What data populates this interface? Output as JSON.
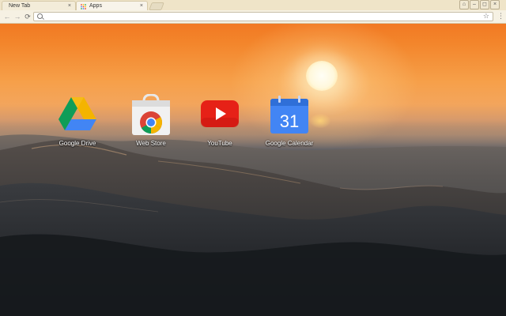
{
  "browser": {
    "tabs": [
      {
        "label": "New Tab",
        "close": "×"
      },
      {
        "label": "Apps",
        "close": "×"
      }
    ],
    "address": {
      "value": "",
      "placeholder": ""
    },
    "nav": {
      "back": "←",
      "forward": "→",
      "reload": "⟳"
    },
    "menu": "⋮",
    "star": "☆"
  },
  "apps": [
    {
      "label": "Google Drive",
      "icon": "google-drive-icon"
    },
    {
      "label": "Web Store",
      "icon": "chrome-web-store-icon"
    },
    {
      "label": "YouTube",
      "icon": "youtube-icon"
    },
    {
      "label": "Google Calendar",
      "icon": "google-calendar-icon",
      "icon_text": "31"
    }
  ],
  "colors": {
    "drive_green": "#0f9d58",
    "drive_yellow": "#f4b400",
    "drive_blue": "#4285f4",
    "youtube_red": "#e62117",
    "calendar_blue": "#4285f4",
    "sky_orange": "#f3862c"
  }
}
